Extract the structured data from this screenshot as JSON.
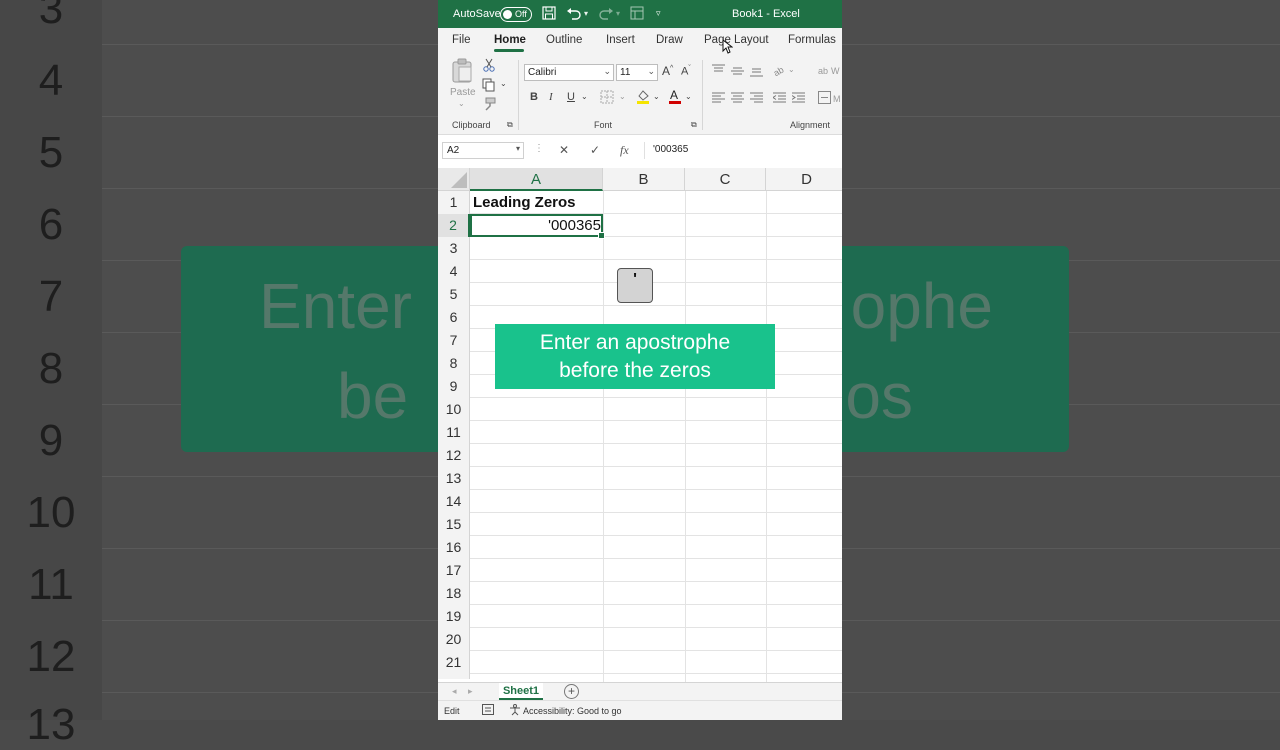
{
  "window": {
    "autosave_label": "AutoSave",
    "autosave_state": "Off",
    "title": "Book1  -  Excel"
  },
  "ribbon_tabs": [
    "File",
    "Home",
    "Outline",
    "Insert",
    "Draw",
    "Page Layout",
    "Formulas"
  ],
  "active_tab": "Home",
  "ribbon": {
    "clipboard": {
      "paste_label": "Paste",
      "group_label": "Clipboard"
    },
    "font": {
      "name": "Calibri",
      "size": "11",
      "group_label": "Font",
      "bold": "B",
      "italic": "I",
      "underline": "U"
    },
    "alignment": {
      "group_label": "Alignment"
    }
  },
  "formula_bar": {
    "name_box": "A2",
    "cancel_icon": "✕",
    "enter_icon": "✓",
    "fx_label": "fx",
    "content": "'000365"
  },
  "sheet": {
    "columns": [
      "A",
      "B",
      "C",
      "D"
    ],
    "selected_column": "A",
    "rows": [
      "1",
      "2",
      "3",
      "4",
      "5",
      "6",
      "7",
      "8",
      "9",
      "10",
      "11",
      "12",
      "13",
      "14",
      "15",
      "16",
      "17",
      "18",
      "19",
      "20",
      "21"
    ],
    "selected_row": "2",
    "cells": {
      "A1": "Leading Zeros",
      "A2": "'000365"
    }
  },
  "overlay": {
    "keycap": "'",
    "callout_line1": "Enter an apostrophe",
    "callout_line2": "before the zeros"
  },
  "sheet_tabs": [
    "Sheet1"
  ],
  "status": {
    "mode": "Edit",
    "accessibility": "Accessibility: Good to go"
  },
  "background": {
    "row_numbers": [
      "3",
      "4",
      "5",
      "6",
      "7",
      "8",
      "9",
      "10",
      "11",
      "12",
      "13"
    ],
    "banner_line1_left": "Enter",
    "banner_line1_right": "ophe",
    "banner_line2_left": "be",
    "banner_line2_right": "os"
  },
  "colors": {
    "excel_green": "#1f7145",
    "callout_green": "#19c28c"
  }
}
